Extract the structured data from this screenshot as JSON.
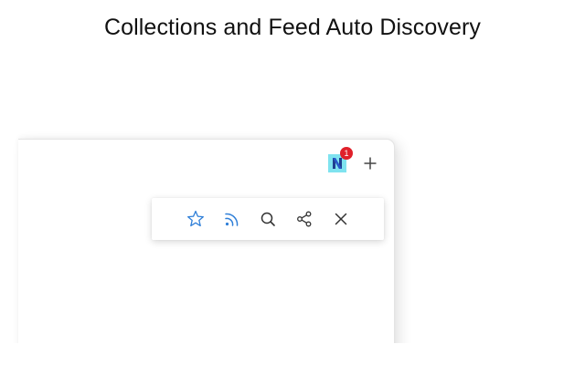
{
  "headline": "Collections and Feed Auto Discovery",
  "extension": {
    "icon": "collections-extension-icon",
    "badge_count": "1",
    "badge_color": "#e0202a"
  },
  "browser": {
    "new_tab_icon": "plus-icon"
  },
  "toolbar": {
    "buttons": [
      {
        "icon": "star-icon",
        "color": "#2f7fd8"
      },
      {
        "icon": "rss-feed-icon",
        "color": "#2f7fd8"
      },
      {
        "icon": "search-icon",
        "color": "#333333"
      },
      {
        "icon": "share-icon",
        "color": "#333333"
      },
      {
        "icon": "close-icon",
        "color": "#333333"
      }
    ]
  }
}
